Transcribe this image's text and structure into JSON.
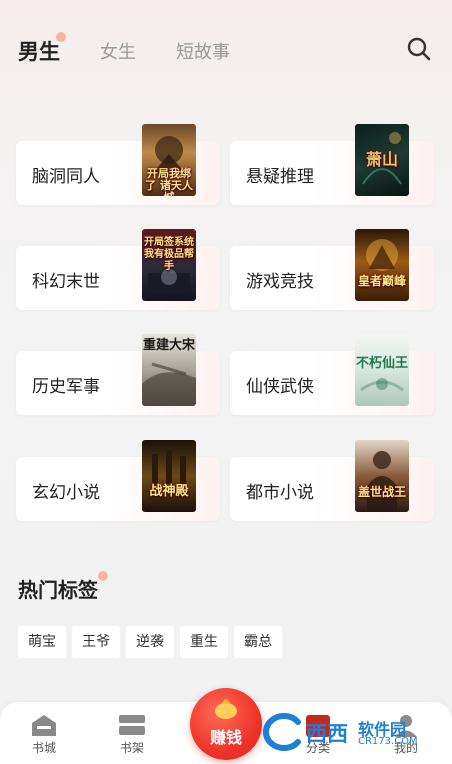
{
  "tabs": [
    {
      "label": "男生",
      "active": true
    },
    {
      "label": "女生",
      "active": false
    },
    {
      "label": "短故事",
      "active": false
    }
  ],
  "categories": [
    {
      "label": "脑洞同人",
      "cover_text": "开局我绑了 诸天人城"
    },
    {
      "label": "悬疑推理",
      "cover_text": "萧山"
    },
    {
      "label": "科幻末世",
      "cover_text": "开局签系统 我有极品帮手"
    },
    {
      "label": "游戏竞技",
      "cover_text": "皇者巅峰"
    },
    {
      "label": "历史军事",
      "cover_text": "重建大宋"
    },
    {
      "label": "仙侠武侠",
      "cover_text": "不朽仙王"
    },
    {
      "label": "玄幻小说",
      "cover_text": "战神殿"
    },
    {
      "label": "都市小说",
      "cover_text": "盖世战王"
    }
  ],
  "hot_tags": {
    "title": "热门标签",
    "items": [
      "萌宝",
      "王爷",
      "逆袭",
      "重生",
      "霸总"
    ]
  },
  "bottom_nav": {
    "items": [
      {
        "label": "书城",
        "icon": "bookstore-icon"
      },
      {
        "label": "书架",
        "icon": "bookshelf-icon"
      },
      {
        "label": "分类",
        "icon": "category-icon"
      },
      {
        "label": "我的",
        "icon": "profile-icon"
      }
    ],
    "earn_label": "赚钱"
  },
  "watermark": {
    "brand": "西西",
    "name": "软件园",
    "url": "CR173.COM"
  },
  "colors": {
    "accent": "#f0342a",
    "tab_dot": "#f3a28e",
    "watermark": "#1e7fd6"
  }
}
